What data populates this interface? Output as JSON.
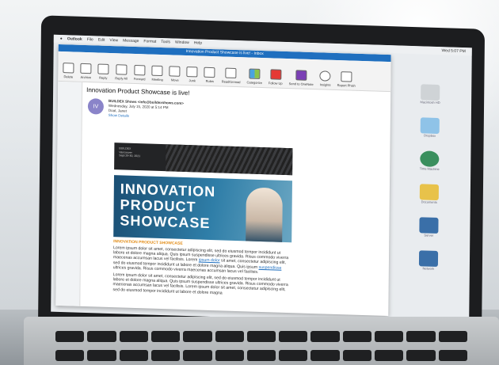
{
  "menubar": {
    "app": "Outlook",
    "items": [
      "File",
      "Edit",
      "View",
      "Message",
      "Format",
      "Tools",
      "Window",
      "Help"
    ],
    "clock": "Wed 5:07 PM"
  },
  "window": {
    "title": "Innovation Product Showcase is live! - Inbox"
  },
  "ribbon": {
    "buttons": [
      "Delete",
      "Archive",
      "Reply",
      "Reply All",
      "Forward",
      "Meeting",
      "Move",
      "Junk",
      "Rules",
      "Read/Unread",
      "Categorize",
      "Follow Up",
      "Send to OneNote",
      "Insights",
      "Report Phish"
    ]
  },
  "message": {
    "subject": "Innovation Product Showcase is live!",
    "avatar_initials": "IV",
    "from": "BUILDEX Shows <info@buildexshows.com>",
    "date": "Wednesday, July 15, 2020 at 5:14 PM",
    "to": "Doat, Janet",
    "show_details": "Show Details"
  },
  "email_body": {
    "banner_lines": [
      "BUILDEX",
      "Vancouver",
      "Sept 29-30, 2021"
    ],
    "hero_lines": [
      "INNOVATION",
      "PRODUCT",
      "SHOWCASE"
    ],
    "section_title": "INNOVATION PRODUCT SHOWCASE",
    "paragraph_1": "Lorem ipsum dolor sit amet, consectetur adipiscing elit, sed do eiusmod tempor incididunt ut labore et dolore magna aliqua. Quis ipsum suspendisse ultrices gravida. Risus commodo viverra maecenas accumsan lacus vel facilisis. Lorem",
    "link_1": "ipsum dolor",
    "paragraph_1b": "sit amet, consectetur adipiscing elit, sed do eiusmod tempor incididunt ut labore et dolore magna aliqua. Quis ipsum",
    "link_2": "suspendisse",
    "paragraph_1c": "ultrices gravida. Risus commodo viverra maecenas accumsan lacus vel facilisis.",
    "paragraph_2": "Lorem ipsum dolor sit amet, consectetur adipiscing elit, sed do eiusmod tempor incididunt ut labore et dolore magna aliqua. Quis ipsum suspendisse ultrices gravida. Risus commodo viverra maecenas accumsan lacus vel facilisis. Lorem ipsum dolor sit amet, consectetur adipiscing elit, sed do eiusmod tempor incididunt ut labore et dolore magna"
  },
  "desktop_icons": [
    "Macintosh HD",
    "Dropbox",
    "Time Machine",
    "Documents",
    "Server",
    "Network"
  ],
  "colors": {
    "outlook_blue": "#1f6fbf",
    "accent_orange": "#e28c16"
  }
}
